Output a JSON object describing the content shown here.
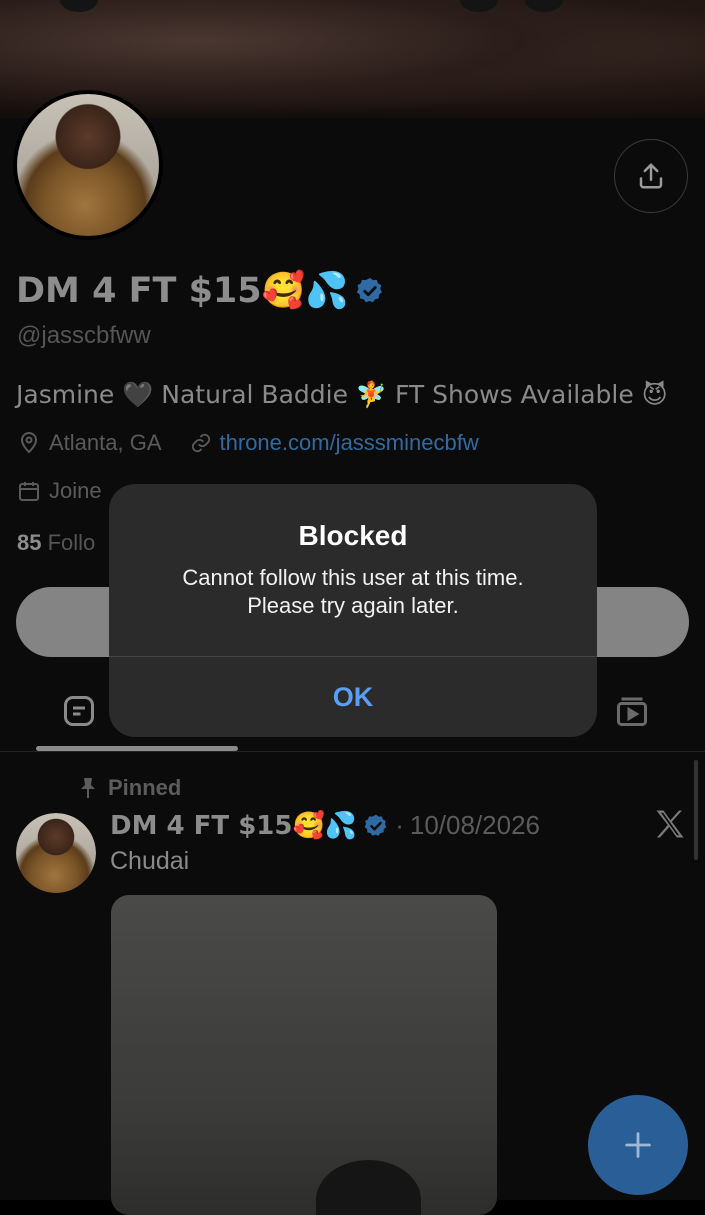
{
  "profile": {
    "display_name": "DM 4 FT $15🥰💦",
    "handle": "@jasscbfww",
    "bio": "Jasmine 🖤 Natural Baddie 🧚 FT Shows Available 😈",
    "location": "Atlanta, GA",
    "website": "throne.com/jasssminecbfw",
    "joined_partial": "Joine",
    "following_count": "85",
    "following_partial": " Follo"
  },
  "dialog": {
    "title": "Blocked",
    "message_line1": "Cannot follow this user at this time.",
    "message_line2": "Please try again later.",
    "ok_label": "OK"
  },
  "tweet": {
    "pinned_label": "Pinned",
    "author": "DM 4 FT $15🥰💦",
    "separator": "·",
    "date": "10/08/2026",
    "text": "Chudai"
  },
  "colors": {
    "accent": "#1d9bf0",
    "ok_text": "#5b9ef6",
    "fab": "#2a5e96"
  },
  "icons": [
    "share-icon",
    "verified-icon",
    "location-icon",
    "link-icon",
    "calendar-icon",
    "tab-posts-icon",
    "tab-media-icon",
    "pin-icon",
    "x-logo-icon",
    "plus-icon"
  ]
}
